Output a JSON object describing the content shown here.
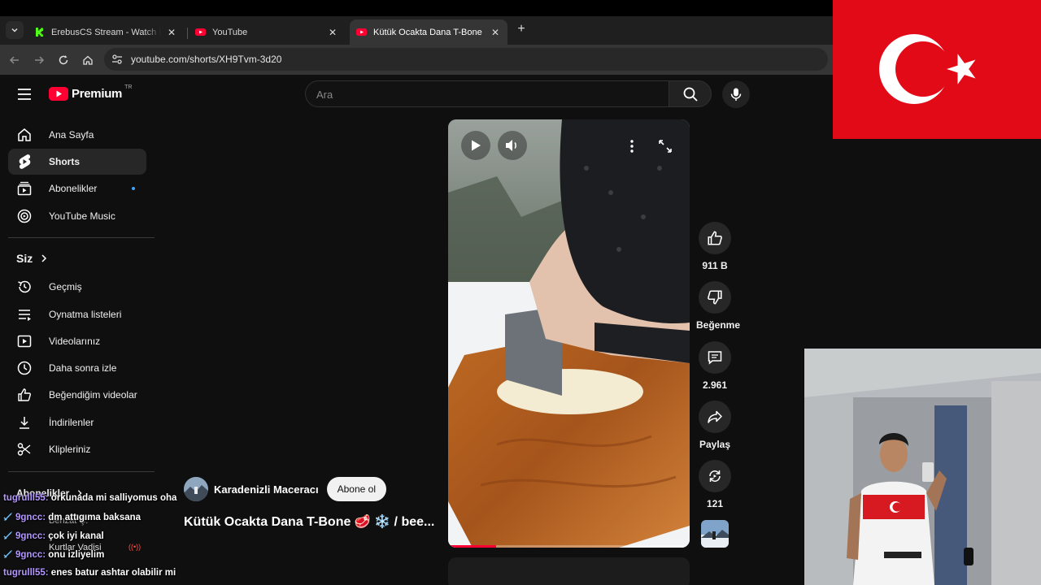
{
  "browser": {
    "tabs": [
      {
        "title": "ErebusCS Stream - Watch Live on Kick",
        "favicon": "kick-logo"
      },
      {
        "title": "YouTube",
        "favicon": "youtube-logo"
      },
      {
        "title": "Kütük Ocakta Dana T-Bone 🥩",
        "favicon": "youtube-logo"
      }
    ],
    "url": "youtube.com/shorts/XH9Tvm-3d20"
  },
  "youtube": {
    "logo": {
      "word": "Premium",
      "region": "TR"
    },
    "search": {
      "placeholder": "Ara"
    },
    "sidebar": {
      "items": [
        {
          "label": "Ana Sayfa",
          "icon": "home-icon"
        },
        {
          "label": "Shorts",
          "icon": "shorts-icon",
          "active": true
        },
        {
          "label": "Abonelikler",
          "icon": "subscriptions-icon",
          "new": true
        },
        {
          "label": "YouTube Music",
          "icon": "music-icon"
        }
      ],
      "you_header": "Siz",
      "you_items": [
        {
          "label": "Geçmiş",
          "icon": "history-icon"
        },
        {
          "label": "Oynatma listeleri",
          "icon": "playlist-icon"
        },
        {
          "label": "Videolarınız",
          "icon": "your-videos-icon"
        },
        {
          "label": "Daha sonra izle",
          "icon": "watch-later-icon"
        },
        {
          "label": "Beğendiğim videolar",
          "icon": "liked-icon"
        },
        {
          "label": "İndirilenler",
          "icon": "download-icon"
        },
        {
          "label": "Klipleriniz",
          "icon": "clips-icon"
        }
      ],
      "subs_header": "Abonelikler",
      "subs_items": [
        {
          "label": "Behzat Ç."
        },
        {
          "label": "Kurtlar Vadisi"
        }
      ]
    },
    "short": {
      "progress_fraction": 0.2,
      "likes": "911 B",
      "dislike_label": "Beğenme",
      "comments": "2.961",
      "share_label": "Paylaş",
      "remix": "121",
      "channel": "Karadenizli Maceracı",
      "subscribe_label": "Abone ol",
      "title": "Kütük Ocakta Dana T-Bone 🥩 ❄️ / bee..."
    }
  },
  "chat": [
    {
      "user": "tugrulll55",
      "message": "orkunada mi salliyomus oha",
      "badge": false
    },
    {
      "user": "9gncc",
      "message": "dm attıgıma baksana",
      "badge": true
    },
    {
      "user": "9gncc",
      "message": "çok iyi kanal",
      "badge": true
    },
    {
      "user": "9gncc",
      "message": "onu izliyelim",
      "badge": true
    },
    {
      "user": "tugrulll55",
      "message": "enes batur ashtar olabilir mi",
      "badge": false
    }
  ],
  "colors": {
    "youtube_red": "#ff0033",
    "flag_red": "#e30a17",
    "chat_user": "#b497ff",
    "accent_blue": "#3ea6ff"
  }
}
